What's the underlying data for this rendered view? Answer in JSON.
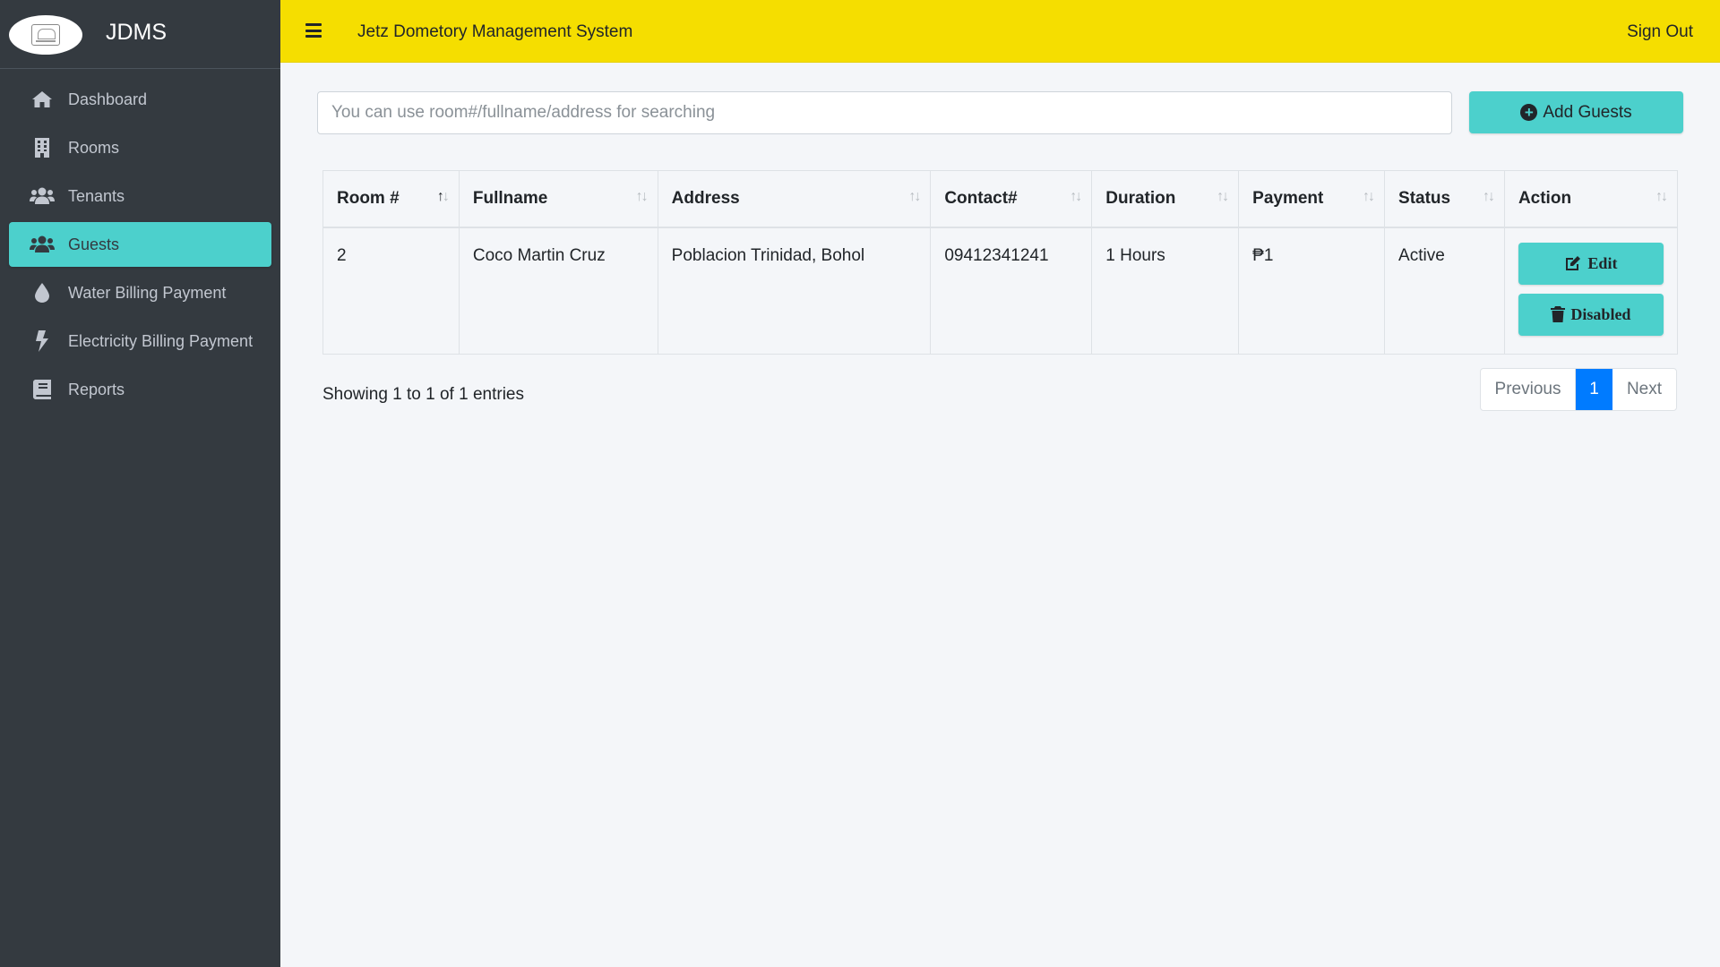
{
  "brand": {
    "title": "JDMS"
  },
  "sidebar": {
    "items": [
      {
        "label": "Dashboard",
        "icon": "home-icon",
        "active": false
      },
      {
        "label": "Rooms",
        "icon": "building-icon",
        "active": false
      },
      {
        "label": "Tenants",
        "icon": "users-icon",
        "active": false
      },
      {
        "label": "Guests",
        "icon": "users-icon",
        "active": true
      },
      {
        "label": "Water Billing Payment",
        "icon": "water-drop-icon",
        "active": false
      },
      {
        "label": "Electricity Billing Payment",
        "icon": "bolt-icon",
        "active": false
      },
      {
        "label": "Reports",
        "icon": "book-icon",
        "active": false
      }
    ]
  },
  "header": {
    "title": "Jetz Dometory Management System",
    "signout": "Sign Out"
  },
  "search": {
    "placeholder": "You can use room#/fullname/address for searching",
    "value": ""
  },
  "add_button": {
    "label": "Add Guests"
  },
  "table": {
    "columns": [
      "Room #",
      "Fullname",
      "Address",
      "Contact#",
      "Duration",
      "Payment",
      "Status",
      "Action"
    ],
    "rows": [
      {
        "room": "2",
        "fullname": "Coco Martin Cruz",
        "address": "Poblacion Trinidad, Bohol",
        "contact": "09412341241",
        "duration": "1 Hours",
        "payment": "₱1",
        "status": "Active"
      }
    ],
    "actions": {
      "edit": "Edit",
      "disable": "Disabled"
    }
  },
  "info": "Showing 1 to 1 of 1 entries",
  "pagination": {
    "previous": "Previous",
    "current": "1",
    "next": "Next"
  },
  "colors": {
    "sidebar_bg": "#343a40",
    "header_bg": "#f5de00",
    "accent": "#4cd0cc",
    "page_active": "#007bff"
  }
}
